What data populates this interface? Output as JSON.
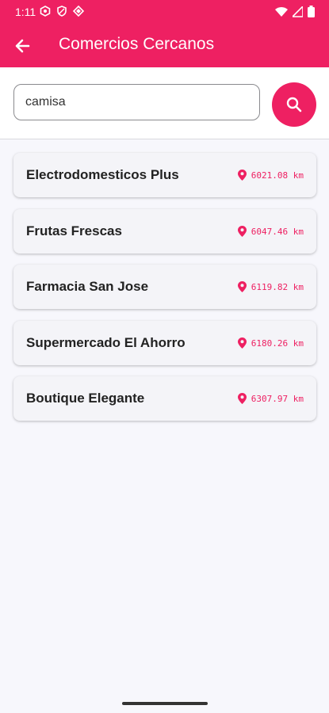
{
  "status_bar": {
    "time": "1:11"
  },
  "app_bar": {
    "title": "Comercios Cercanos"
  },
  "search": {
    "value": "camisa"
  },
  "stores": [
    {
      "name": "Electrodomesticos Plus",
      "distance": "6021.08 km"
    },
    {
      "name": "Frutas Frescas",
      "distance": "6047.46 km"
    },
    {
      "name": "Farmacia San Jose",
      "distance": "6119.82 km"
    },
    {
      "name": "Supermercado El Ahorro",
      "distance": "6180.26 km"
    },
    {
      "name": "Boutique Elegante",
      "distance": "6307.97 km"
    }
  ],
  "colors": {
    "accent": "#ee2062",
    "background": "#f7f7fc",
    "card": "#f4f4f8"
  },
  "icons": {
    "back": "arrow-back-icon",
    "search": "search-icon",
    "location": "location-pin-icon"
  }
}
